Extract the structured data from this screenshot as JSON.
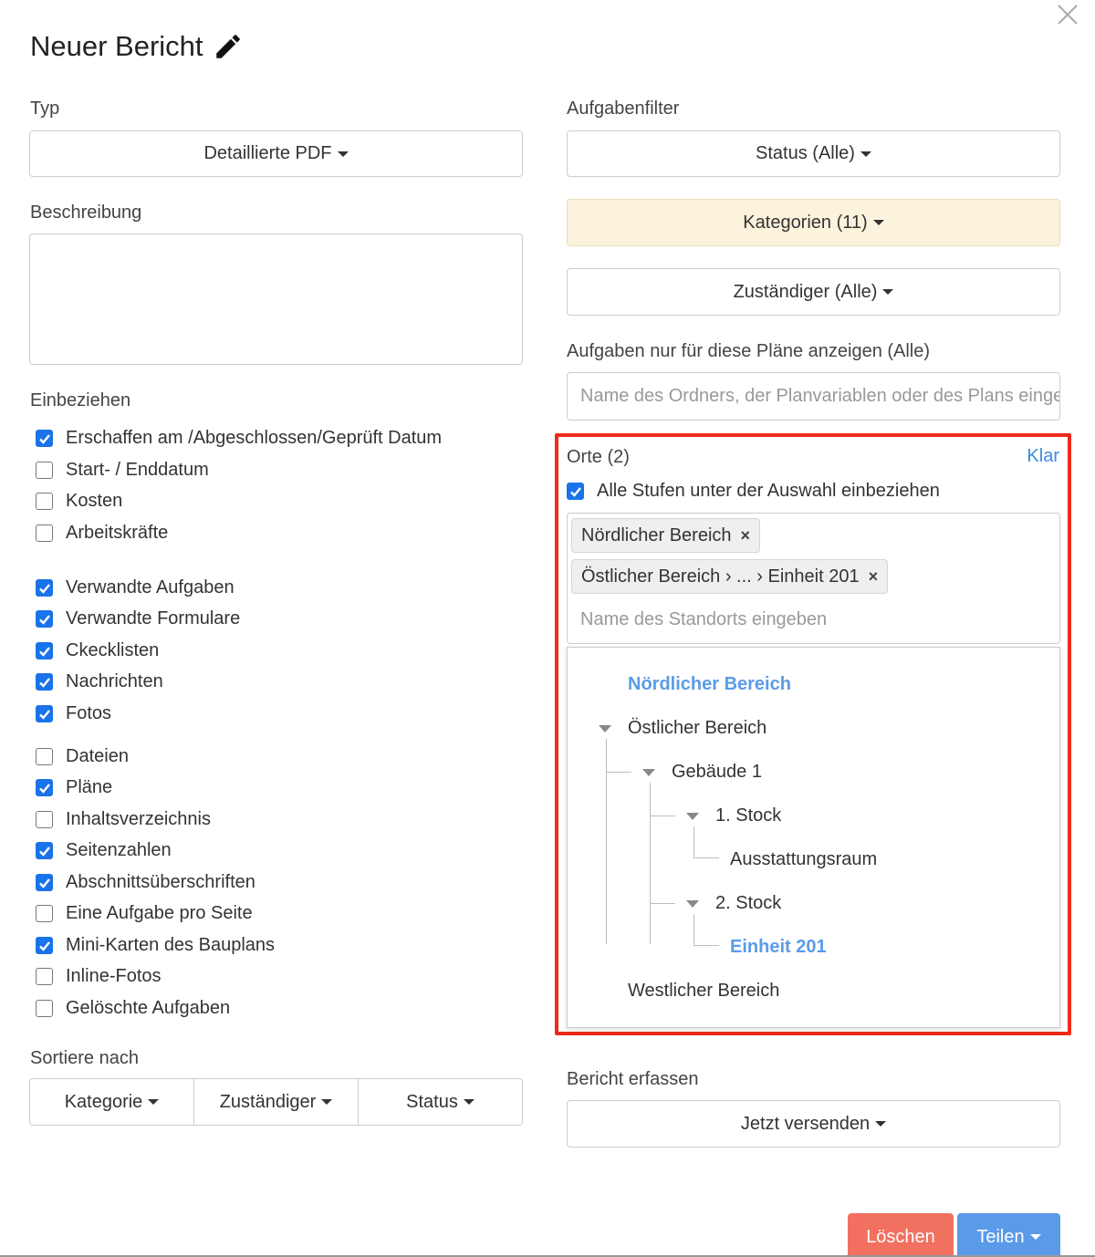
{
  "dialog": {
    "title": "Neuer Bericht"
  },
  "left": {
    "typ_label": "Typ",
    "typ_value": "Detaillierte PDF",
    "beschreibung_label": "Beschreibung",
    "einbeziehen_label": "Einbeziehen",
    "checkboxes": [
      {
        "label": "Erschaffen am /Abgeschlossen/Geprüft Datum",
        "checked": true
      },
      {
        "label": "Start- / Enddatum",
        "checked": false
      },
      {
        "label": "Kosten",
        "checked": false
      },
      {
        "label": "Arbeitskräfte",
        "checked": false
      },
      {
        "label": "Verwandte Aufgaben",
        "checked": true
      },
      {
        "label": "Verwandte Formulare",
        "checked": true
      },
      {
        "label": "Ckecklisten",
        "checked": true
      },
      {
        "label": "Nachrichten",
        "checked": true
      },
      {
        "label": "Fotos",
        "checked": true
      },
      {
        "label": "Dateien",
        "checked": false
      },
      {
        "label": "Pläne",
        "checked": true
      },
      {
        "label": "Inhaltsverzeichnis",
        "checked": false
      },
      {
        "label": "Seitenzahlen",
        "checked": true
      },
      {
        "label": "Abschnittsüberschriften",
        "checked": true
      },
      {
        "label": "Eine Aufgabe pro Seite",
        "checked": false
      },
      {
        "label": "Mini-Karten des Bauplans",
        "checked": true
      },
      {
        "label": "Inline-Fotos",
        "checked": false
      },
      {
        "label": "Gelöschte Aufgaben",
        "checked": false
      }
    ],
    "sort_label": "Sortiere nach",
    "sort_options": [
      "Kategorie",
      "Zuständiger",
      "Status"
    ]
  },
  "right": {
    "aufgabenfilter_label": "Aufgabenfilter",
    "status_button": "Status (Alle)",
    "kategorien_button": "Kategorien (11)",
    "zustaendiger_button": "Zuständiger (Alle)",
    "plaene_label": "Aufgaben nur für diese Pläne anzeigen (Alle)",
    "plaene_placeholder": "Name des Ordners, der Planvariablen oder des Plans eingeben",
    "orte_label": "Orte (2)",
    "klar_link": "Klar",
    "alle_stufen_label": "Alle Stufen unter der Auswahl einbeziehen",
    "alle_stufen_checked": true,
    "tags": [
      "Nördlicher Bereich",
      "Östlicher Bereich › ... › Einheit 201"
    ],
    "tag_remove": "×",
    "standort_placeholder": "Name des Standorts eingeben",
    "tree": {
      "n1": "Nördlicher Bereich",
      "n2": "Östlicher Bereich",
      "n3": "Gebäude 1",
      "n4": "1. Stock",
      "n5": "Ausstattungsraum",
      "n6": "2. Stock",
      "n7": "Einheit 201",
      "n8": "Westlicher Bereich"
    },
    "bericht_label": "Bericht erfassen",
    "bericht_button": "Jetzt versenden"
  },
  "footer": {
    "delete": "Löschen",
    "share": "Teilen"
  },
  "colors": {
    "accent": "#1a73e8",
    "highlight_frame": "#f02a1a",
    "selected_node": "#5a9be8",
    "danger": "#f2705f",
    "primary": "#5b9ae9",
    "kategorien_bg": "#fcf3dc"
  }
}
